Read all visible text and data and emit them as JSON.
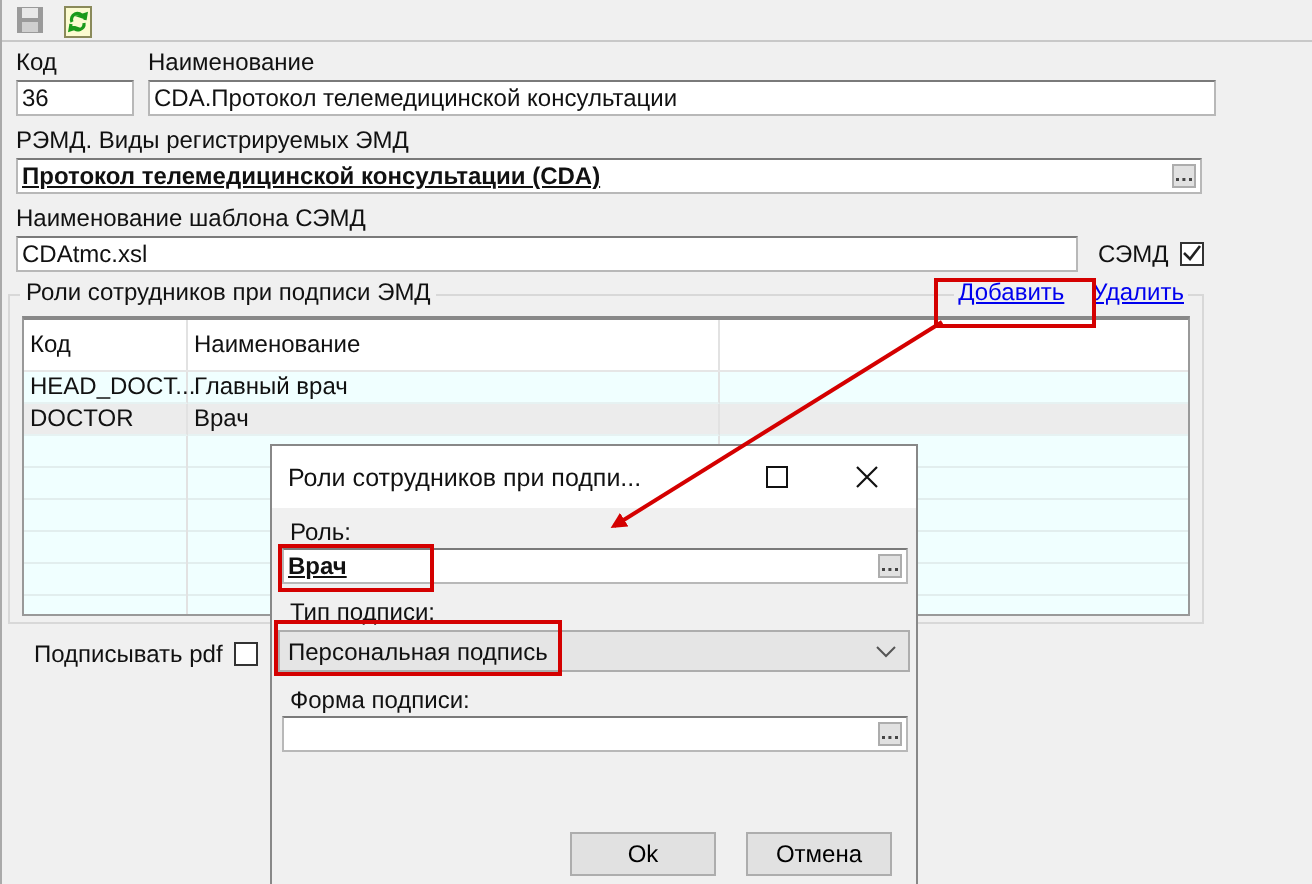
{
  "toolbar": {
    "buttons": [
      {
        "kind": "save",
        "disabled": true
      },
      {
        "kind": "refresh",
        "disabled": false
      }
    ]
  },
  "form": {
    "code_label": "Код",
    "code_value": "36",
    "name_label": "Наименование",
    "name_value": "CDA.Протокол телемедицинской консультации",
    "remd_label": "РЭМД. Виды регистрируемых ЭМД",
    "remd_value": "Протокол телемедицинской консультации (CDA)",
    "template_label": "Наименование шаблона СЭМД",
    "template_value": "CDAtmc.xsl",
    "semd": {
      "label": "СЭМД",
      "checked": true
    }
  },
  "roles_group": {
    "title": "Роли сотрудников при подписи ЭМД",
    "links": [
      "Добавить",
      "Удалить"
    ],
    "table": {
      "columns": [
        "Код",
        "Наименование"
      ],
      "rows": [
        {
          "cells": [
            "HEAD_DOCT...",
            "Главный врач"
          ],
          "selected": false
        },
        {
          "cells": [
            "DOCTOR",
            "Врач"
          ],
          "selected": true
        }
      ]
    }
  },
  "sign_pdf": {
    "label": "Подписывать pdf",
    "checked": false
  },
  "dialog": {
    "title": "Роли сотрудников при подпи...",
    "role_label": "Роль:",
    "role_value": "Врач",
    "sign_type_label": "Тип подписи:",
    "sign_type_value": "Персональная подпись",
    "sign_form_label": "Форма подписи:",
    "buttons": [
      "Ok",
      "Отмена"
    ]
  }
}
